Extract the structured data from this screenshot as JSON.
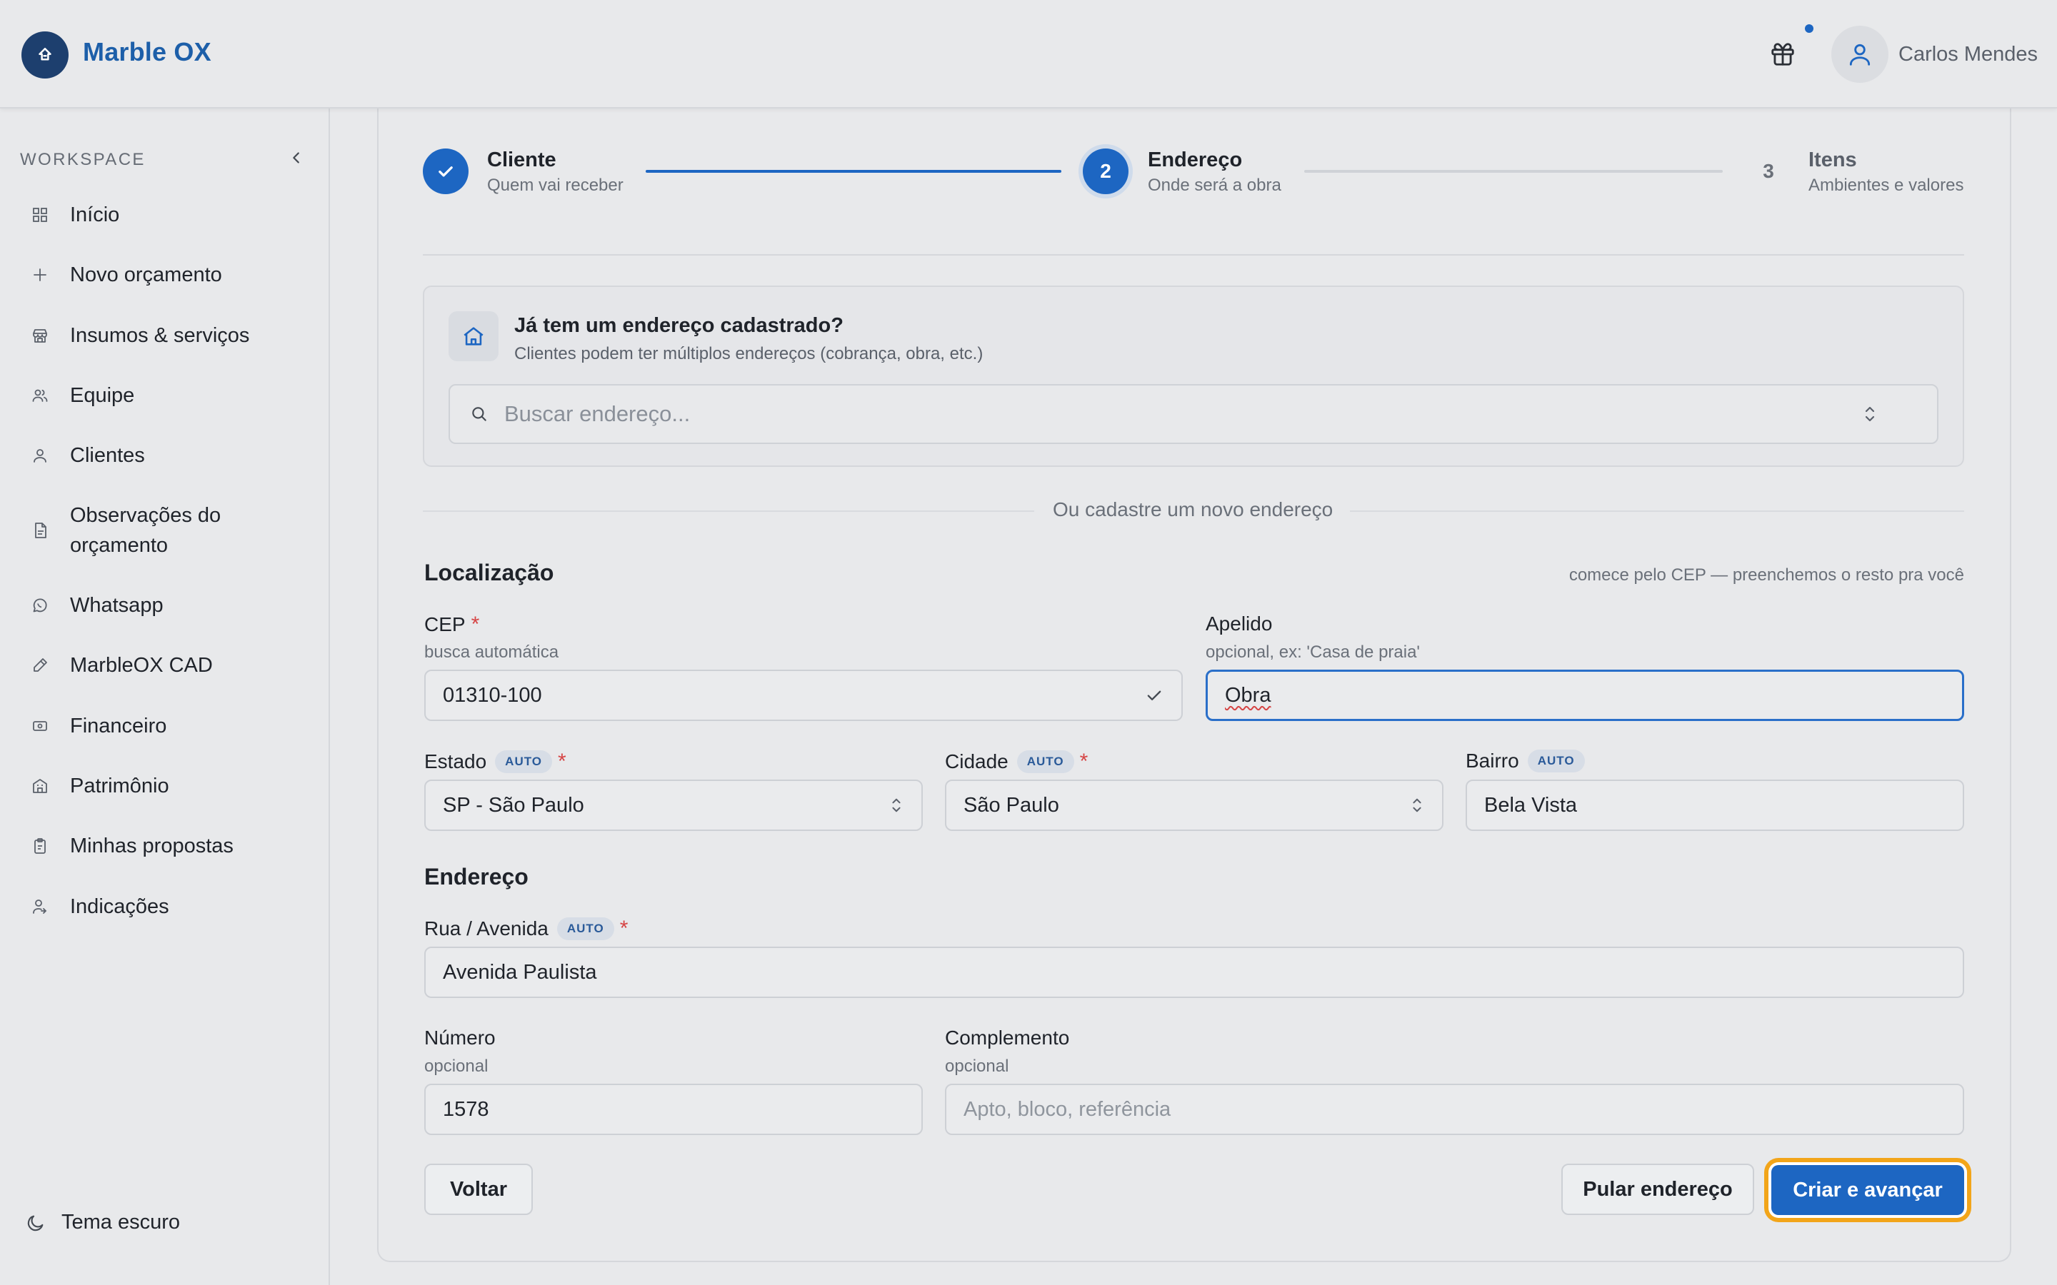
{
  "app": {
    "name": "Marble OX"
  },
  "header": {
    "user_name": "Carlos Mendes"
  },
  "sidebar": {
    "section_label": "WORKSPACE",
    "items": [
      {
        "label": "Início",
        "icon": "grid-icon"
      },
      {
        "label": "Novo orçamento",
        "icon": "plus-icon"
      },
      {
        "label": "Insumos & serviços",
        "icon": "store-icon"
      },
      {
        "label": "Equipe",
        "icon": "users-icon"
      },
      {
        "label": "Clientes",
        "icon": "user-icon"
      },
      {
        "label": "Observações do orçamento",
        "icon": "document-icon"
      },
      {
        "label": "Whatsapp",
        "icon": "whatsapp-icon"
      },
      {
        "label": "MarbleOX CAD",
        "icon": "pencil-icon"
      },
      {
        "label": "Financeiro",
        "icon": "cash-icon"
      },
      {
        "label": "Patrimônio",
        "icon": "building-icon"
      },
      {
        "label": "Minhas propostas",
        "icon": "clipboard-icon"
      },
      {
        "label": "Indicações",
        "icon": "user-share-icon"
      }
    ],
    "theme_toggle": "Tema escuro"
  },
  "stepper": {
    "steps": [
      {
        "number": "",
        "title": "Cliente",
        "subtitle": "Quem vai receber",
        "state": "done"
      },
      {
        "number": "2",
        "title": "Endereço",
        "subtitle": "Onde será a obra",
        "state": "active"
      },
      {
        "number": "3",
        "title": "Itens",
        "subtitle": "Ambientes e valores",
        "state": "pending"
      }
    ]
  },
  "existing_address": {
    "title": "Já tem um endereço cadastrado?",
    "subtitle": "Clientes podem ter múltiplos endereços (cobrança, obra, etc.)",
    "search_placeholder": "Buscar endereço..."
  },
  "or_divider": "Ou cadastre um novo endereço",
  "location": {
    "title": "Localização",
    "hint": "comece pelo CEP — preenchemos o resto pra você",
    "cep": {
      "label": "CEP",
      "sub": "busca automática",
      "value": "01310-100"
    },
    "apelido": {
      "label": "Apelido",
      "sub": "opcional, ex: 'Casa de praia'",
      "value": "Obra"
    },
    "estado": {
      "label": "Estado",
      "badge": "AUTO",
      "value": "SP - São Paulo"
    },
    "cidade": {
      "label": "Cidade",
      "badge": "AUTO",
      "value": "São Paulo"
    },
    "bairro": {
      "label": "Bairro",
      "badge": "AUTO",
      "value": "Bela Vista"
    }
  },
  "address": {
    "title": "Endereço",
    "rua": {
      "label": "Rua / Avenida",
      "badge": "AUTO",
      "value": "Avenida Paulista"
    },
    "numero": {
      "label": "Número",
      "sub": "opcional",
      "value": "1578"
    },
    "complemento": {
      "label": "Complemento",
      "sub": "opcional",
      "placeholder": "Apto, bloco, referência"
    }
  },
  "required_mark": "*",
  "actions": {
    "back": "Voltar",
    "skip": "Pular endereço",
    "create": "Criar e avançar"
  },
  "colors": {
    "primary": "#1d66c2",
    "brand_dark": "#1d3f6e",
    "focus_ring": "#f2a51a",
    "required": "#d64545"
  }
}
